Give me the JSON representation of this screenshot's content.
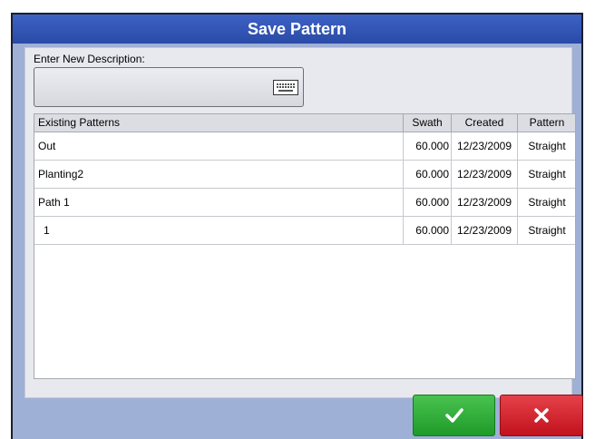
{
  "dialog": {
    "title": "Save Pattern",
    "description_label": "Enter New Description:",
    "description_value": ""
  },
  "table": {
    "headers": [
      "Existing Patterns",
      "Swath",
      "Created",
      "Pattern"
    ],
    "rows": [
      {
        "name": "Out",
        "swath": "60.000",
        "created": "12/23/2009",
        "pattern": "Straight"
      },
      {
        "name": "Planting2",
        "swath": "60.000",
        "created": "12/23/2009",
        "pattern": "Straight"
      },
      {
        "name": "Path 1",
        "swath": "60.000",
        "created": "12/23/2009",
        "pattern": "Straight"
      },
      {
        "name": " 1",
        "swath": "60.000",
        "created": "12/23/2009",
        "pattern": "Straight"
      }
    ]
  },
  "buttons": {
    "ok_icon": "checkmark-icon",
    "cancel_icon": "x-icon",
    "ok_color": "#2aaa33",
    "cancel_color": "#d0202a"
  },
  "keyboard_icon": "keyboard-icon"
}
